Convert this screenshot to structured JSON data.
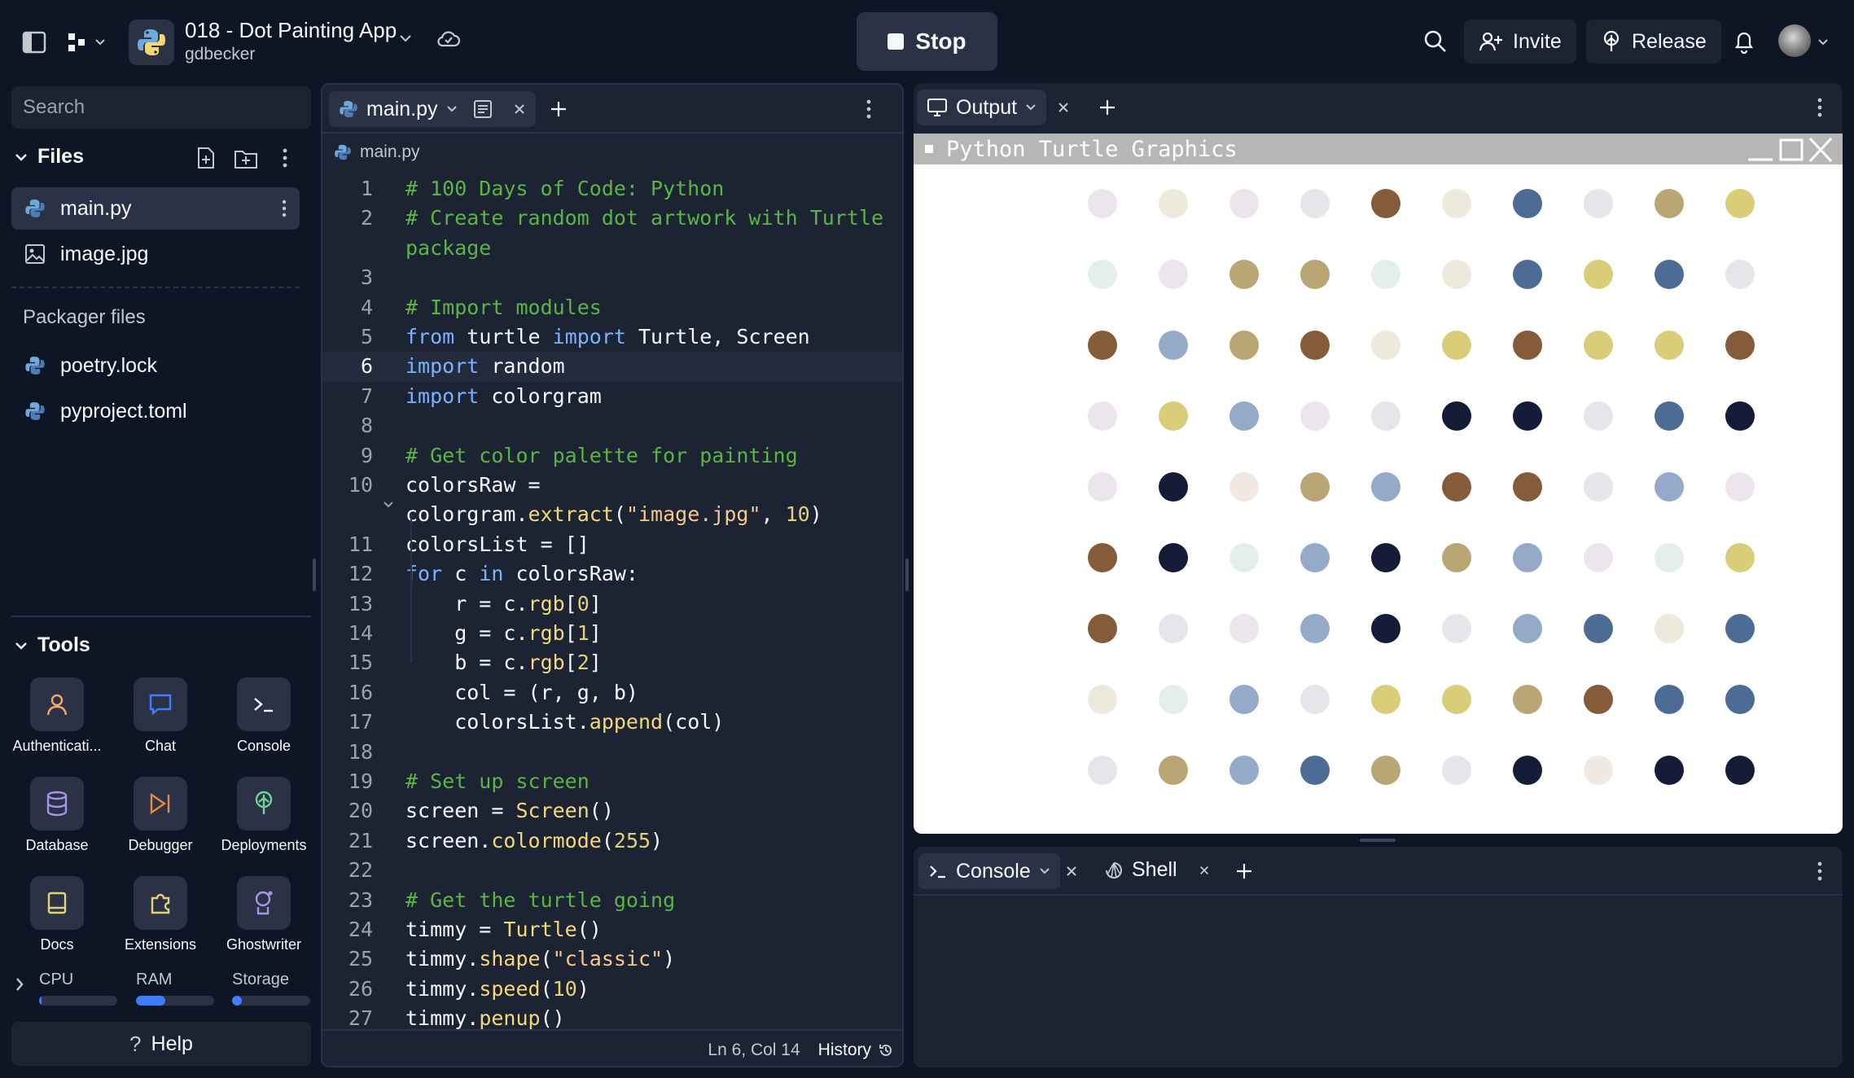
{
  "header": {
    "app_title": "018 - Dot Painting App",
    "owner": "gdbecker",
    "stop_label": "Stop",
    "invite_label": "Invite",
    "release_label": "Release"
  },
  "sidebar": {
    "search_placeholder": "Search",
    "files_title": "Files",
    "files": [
      {
        "name": "main.py",
        "icon": "python-icon"
      },
      {
        "name": "image.jpg",
        "icon": "image-icon"
      }
    ],
    "packager_title": "Packager files",
    "packager_files": [
      {
        "name": "poetry.lock",
        "icon": "python-icon"
      },
      {
        "name": "pyproject.toml",
        "icon": "python-icon"
      }
    ],
    "tools_title": "Tools",
    "tools": [
      {
        "label": "Authenticati...",
        "icon": "person-icon"
      },
      {
        "label": "Chat",
        "icon": "chat-icon"
      },
      {
        "label": "Console",
        "icon": "terminal-icon"
      },
      {
        "label": "Database",
        "icon": "database-icon"
      },
      {
        "label": "Debugger",
        "icon": "debugger-icon"
      },
      {
        "label": "Deployments",
        "icon": "deploy-icon"
      },
      {
        "label": "Docs",
        "icon": "book-icon"
      },
      {
        "label": "Extensions",
        "icon": "puzzle-icon"
      },
      {
        "label": "Ghostwriter",
        "icon": "ghostwriter-icon"
      }
    ],
    "meters": [
      {
        "label": "CPU",
        "level": 0.03
      },
      {
        "label": "RAM",
        "level": 0.38
      },
      {
        "label": "Storage",
        "level": 0.12
      }
    ],
    "help_label": "Help"
  },
  "editor": {
    "tab_label": "main.py",
    "breadcrumb": "main.py",
    "current_line": 6,
    "lines": [
      {
        "n": "1",
        "html": "<span class=\"c-cm\"># 100 Days of Code: Python</span>"
      },
      {
        "n": "2",
        "html": "<span class=\"c-cm\"># Create random dot artwork with Turtle</span>"
      },
      {
        "n": "",
        "html": "<span class=\"c-cm\">package</span>"
      },
      {
        "n": "3",
        "html": ""
      },
      {
        "n": "4",
        "html": "<span class=\"c-cm\"># Import modules</span>"
      },
      {
        "n": "5",
        "html": "<span class=\"c-kw\">from</span> turtle <span class=\"c-kw\">import</span> Turtle, Screen"
      },
      {
        "n": "6",
        "html": "<span class=\"c-kw\">import</span> random"
      },
      {
        "n": "7",
        "html": "<span class=\"c-kw\">import</span> colorgram"
      },
      {
        "n": "8",
        "html": ""
      },
      {
        "n": "9",
        "html": "<span class=\"c-cm\"># Get color palette for painting</span>"
      },
      {
        "n": "10",
        "html": "colorsRaw ="
      },
      {
        "n": "",
        "html": "colorgram.<span class=\"c-fn\">extract</span>(<span class=\"c-st\">\"image.jpg\"</span>, <span class=\"c-nm\">10</span>)"
      },
      {
        "n": "11",
        "html": "colorsList = []"
      },
      {
        "n": "12",
        "html": "<span class=\"c-kw\">for</span> c <span class=\"c-kw\">in</span> colorsRaw:"
      },
      {
        "n": "13",
        "html": "    r = c.<span class=\"c-fn\">rgb</span>[<span class=\"c-nm\">0</span>]"
      },
      {
        "n": "14",
        "html": "    g = c.<span class=\"c-fn\">rgb</span>[<span class=\"c-nm\">1</span>]"
      },
      {
        "n": "15",
        "html": "    b = c.<span class=\"c-fn\">rgb</span>[<span class=\"c-nm\">2</span>]"
      },
      {
        "n": "16",
        "html": "    col = (r, g, b)"
      },
      {
        "n": "17",
        "html": "    colorsList.<span class=\"c-fn\">append</span>(col)"
      },
      {
        "n": "18",
        "html": ""
      },
      {
        "n": "19",
        "html": "<span class=\"c-cm\"># Set up screen</span>"
      },
      {
        "n": "20",
        "html": "screen = <span class=\"c-fn\">Screen</span>()"
      },
      {
        "n": "21",
        "html": "screen.<span class=\"c-fn\">colormode</span>(<span class=\"c-nm\">255</span>)"
      },
      {
        "n": "22",
        "html": ""
      },
      {
        "n": "23",
        "html": "<span class=\"c-cm\"># Get the turtle going</span>"
      },
      {
        "n": "24",
        "html": "timmy = <span class=\"c-fn\">Turtle</span>()"
      },
      {
        "n": "25",
        "html": "timmy.<span class=\"c-fn\">shape</span>(<span class=\"c-st\">\"classic\"</span>)"
      },
      {
        "n": "26",
        "html": "timmy.<span class=\"c-fn\">speed</span>(<span class=\"c-nm\">10</span>)"
      },
      {
        "n": "27",
        "html": "timmy.<span class=\"c-fn\">penup</span>()"
      }
    ],
    "status_position": "Ln 6, Col 14",
    "history_label": "History"
  },
  "output": {
    "tab_label": "Output",
    "window_title": "Python Turtle Graphics",
    "palette": {
      "a": "#ece6ec",
      "b": "#ede9dc",
      "c": "#e5e5ea",
      "d": "#845c3a",
      "e": "#4c6c96",
      "f": "#baa574",
      "g": "#d9cd7a",
      "h": "#e5efea",
      "i": "#94aac8",
      "j": "#141c38",
      "k": "#f0e9e3"
    },
    "dot_rows": [
      [
        "a",
        "b",
        "a",
        "c",
        "d",
        "b",
        "e",
        "c",
        "f",
        "g"
      ],
      [
        "h",
        "a",
        "f",
        "f",
        "h",
        "b",
        "e",
        "g",
        "e",
        "c"
      ],
      [
        "d",
        "i",
        "f",
        "d",
        "b",
        "g",
        "d",
        "g",
        "g",
        "d"
      ],
      [
        "a",
        "g",
        "i",
        "a",
        "c",
        "j",
        "j",
        "c",
        "e",
        "j"
      ],
      [
        "a",
        "j",
        "k",
        "f",
        "i",
        "d",
        "d",
        "c",
        "i",
        "a"
      ],
      [
        "d",
        "j",
        "h",
        "i",
        "j",
        "f",
        "i",
        "a",
        "h",
        "g"
      ],
      [
        "d",
        "c",
        "a",
        "i",
        "j",
        "c",
        "i",
        "e",
        "b",
        "e"
      ],
      [
        "b",
        "h",
        "i",
        "c",
        "g",
        "g",
        "f",
        "d",
        "e",
        "e"
      ],
      [
        "c",
        "f",
        "i",
        "e",
        "f",
        "c",
        "j",
        "k",
        "j",
        "j"
      ]
    ]
  },
  "console": {
    "tab_console": "Console",
    "tab_shell": "Shell"
  }
}
